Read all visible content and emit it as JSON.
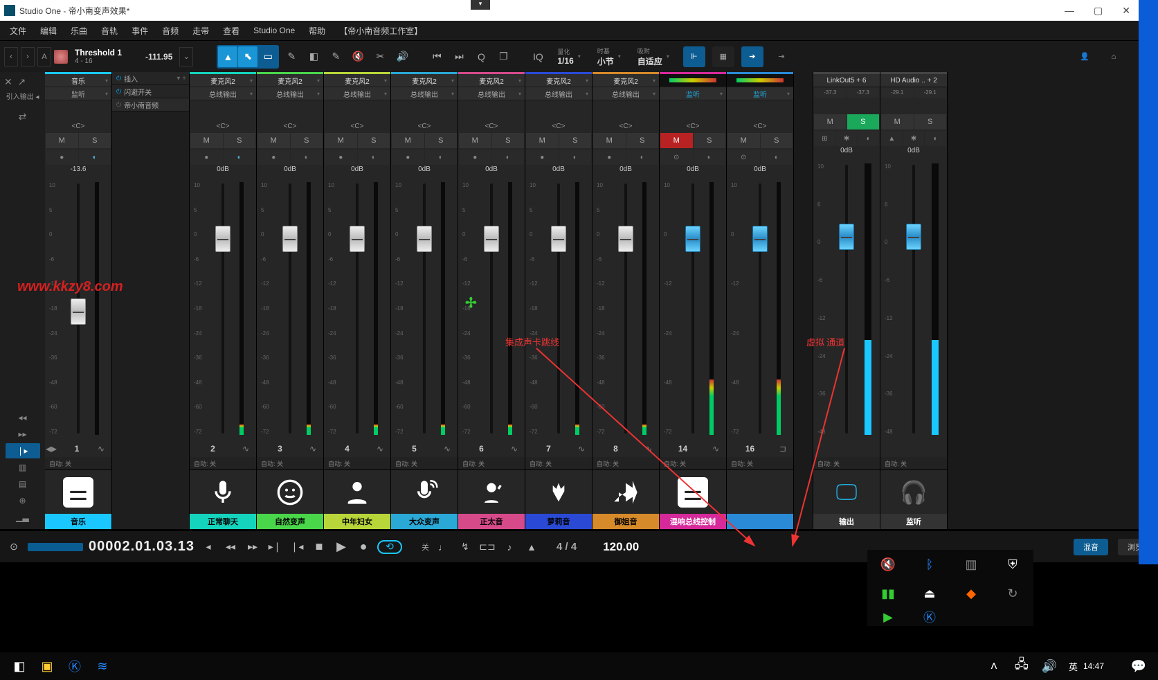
{
  "window": {
    "title": "Studio One - 帝小南变声效果*",
    "vtab": "▾"
  },
  "menubar": [
    "文件",
    "编辑",
    "乐曲",
    "音轨",
    "事件",
    "音频",
    "走带",
    "查看",
    "Studio One",
    "帮助",
    "【帝小南音频工作室】"
  ],
  "toolbar": {
    "threshold_label": "Threshold 1",
    "threshold_sub": "4 - 16",
    "threshold_val": "-111.95",
    "iq": "IQ",
    "quantize_label": "量化",
    "quantize_val": "1/16",
    "timebase_label": "时基",
    "timebase_val": "小节",
    "snap_label": "吸附",
    "snap_val": "自适应"
  },
  "inserts": {
    "header1": "插入",
    "header2": "闪避开关",
    "header3": "帝小南音频"
  },
  "strip0": {
    "io1": "音乐",
    "io2": "监听",
    "pan": "<C>",
    "db": "-13.6",
    "num": "1",
    "auto": "自动: 关",
    "name": "音乐"
  },
  "common": {
    "pan": "<C>",
    "db": "0dB",
    "auto": "自动: 关",
    "input": "麦克风2",
    "output": "总线输出",
    "monitor": "监听"
  },
  "strips": [
    {
      "num": "2",
      "name": "正常聊天",
      "accent": "#15d4bd"
    },
    {
      "num": "3",
      "name": "自然变声",
      "accent": "#4ad64a"
    },
    {
      "num": "4",
      "name": "中年妇女",
      "accent": "#b8d63a"
    },
    {
      "num": "5",
      "name": "大众变声",
      "accent": "#2aa8d6"
    },
    {
      "num": "6",
      "name": "正太音",
      "accent": "#d64a8a"
    },
    {
      "num": "7",
      "name": "萝莉音",
      "accent": "#2a4ad6"
    },
    {
      "num": "8",
      "name": "御姐音",
      "accent": "#d68a2a"
    }
  ],
  "bus14": {
    "num": "14",
    "name": "混响总线控制",
    "accent": "#d62a9a",
    "db": "0dB"
  },
  "bus16": {
    "num": "16",
    "name": "",
    "accent": "#2a8ad6",
    "db": "0dB"
  },
  "output1": {
    "name": "LinkOut5 + 6",
    "peak_l": "-37.3",
    "peak_r": "-37.3",
    "db": "0dB",
    "num": "",
    "label": "输出",
    "auto": "自动: 关"
  },
  "output2": {
    "name": "HD Audio .. + 2",
    "peak_l": "-29.1",
    "peak_r": "-29.1",
    "db": "0dB",
    "label": "监听",
    "auto": "自动: 关"
  },
  "fader_scale_main": [
    "10",
    "5",
    "0",
    "-6",
    "-12",
    "-18",
    "-24",
    "-36",
    "-48",
    "-60",
    "-72"
  ],
  "fader_scale_out": [
    "10",
    "6",
    "0",
    "-6",
    "-12",
    "-24",
    "-36",
    "-48"
  ],
  "transport": {
    "timecode": "00002.01.03.13",
    "off_label": "关",
    "timesig": "4 / 4",
    "tempo": "120.00",
    "mix_btn": "混音",
    "browse_btn": "浏览"
  },
  "annotations": {
    "watermark": "www.kkzy8.com",
    "a1": "集成声卡跳线",
    "a2": "虚拟 通道"
  },
  "taskbar": {
    "ime": "英",
    "time": "14:47"
  }
}
